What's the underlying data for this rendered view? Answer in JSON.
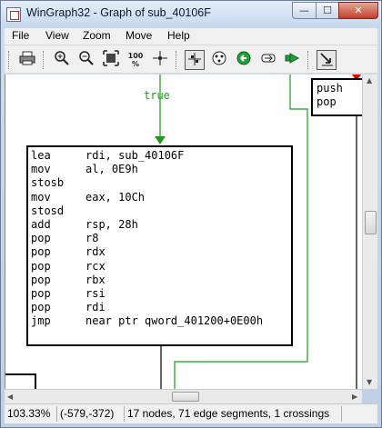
{
  "window": {
    "title": "WinGraph32 - Graph of sub_40106F",
    "min_label": "—",
    "max_label": "☐",
    "close_label": "✕"
  },
  "menu": {
    "items": [
      {
        "label": "File"
      },
      {
        "label": "View"
      },
      {
        "label": "Zoom"
      },
      {
        "label": "Move"
      },
      {
        "label": "Help"
      }
    ]
  },
  "toolbar": {
    "buttons": [
      {
        "icon": "print-icon"
      },
      {
        "icon": "zoom-in-icon"
      },
      {
        "icon": "zoom-out-icon"
      },
      {
        "icon": "fit-window-icon"
      },
      {
        "icon": "zoom-100-icon",
        "label": "100\n%"
      },
      {
        "icon": "crosshair-icon"
      },
      {
        "icon": "layout-icon"
      },
      {
        "icon": "circle-dots-icon"
      },
      {
        "icon": "green-arrow-left-icon"
      },
      {
        "icon": "arrow-outline-icon"
      },
      {
        "icon": "green-arrow-right-icon"
      },
      {
        "icon": "select-mode-icon"
      }
    ]
  },
  "graph": {
    "edge_label": "true",
    "node_main": {
      "instructions": [
        {
          "op": "lea",
          "args": "rdi, sub_40106F"
        },
        {
          "op": "mov",
          "args": "al, 0E9h"
        },
        {
          "op": "stosb",
          "args": ""
        },
        {
          "op": "mov",
          "args": "eax, 10Ch"
        },
        {
          "op": "stosd",
          "args": ""
        },
        {
          "op": "add",
          "args": "rsp, 28h"
        },
        {
          "op": "pop",
          "args": "r8"
        },
        {
          "op": "pop",
          "args": "rdx"
        },
        {
          "op": "pop",
          "args": "rcx"
        },
        {
          "op": "pop",
          "args": "rbx"
        },
        {
          "op": "pop",
          "args": "rsi"
        },
        {
          "op": "pop",
          "args": "rdi"
        },
        {
          "op": "jmp",
          "args": "near ptr qword_401200+0E00h"
        }
      ]
    },
    "node_right": {
      "instructions": [
        {
          "op": "push",
          "args": ""
        },
        {
          "op": "pop",
          "args": ""
        }
      ]
    },
    "colors": {
      "edge_true": "#1e9a1e",
      "edge_normal": "#000000",
      "arrow_red": "#e00000"
    }
  },
  "status": {
    "zoom": "103.33%",
    "coords": "(-579,-372)",
    "summary": "17 nodes, 71 edge segments, 1 crossings"
  }
}
